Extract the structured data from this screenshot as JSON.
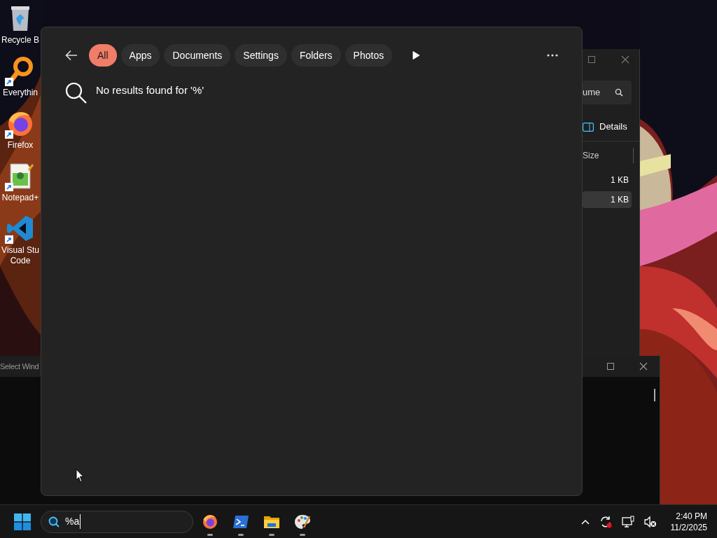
{
  "desktop": {
    "icons": [
      {
        "kind": "bin",
        "lines": [
          "Recycle B"
        ],
        "shortcut": false
      },
      {
        "kind": "magnifier",
        "lines": [
          "Everythin"
        ],
        "shortcut": true
      },
      {
        "kind": "browser",
        "lines": [
          "Firefox"
        ],
        "shortcut": true
      },
      {
        "kind": "notepad",
        "lines": [
          "Notepad+"
        ],
        "shortcut": true
      },
      {
        "kind": "editor",
        "lines": [
          "Visual Stu",
          "Code"
        ],
        "shortcut": true
      }
    ]
  },
  "explorer_window": {
    "search_value": "ume",
    "view_button": "Details",
    "columns": [
      "Size"
    ],
    "rows": [
      {
        "size": "1 KB",
        "selected": false
      },
      {
        "size": "1 KB",
        "selected": true
      }
    ]
  },
  "console_window": {
    "title": "Select Wind"
  },
  "search_panel": {
    "filters": [
      {
        "label": "All",
        "selected": true
      },
      {
        "label": "Apps",
        "selected": false
      },
      {
        "label": "Documents",
        "selected": false
      },
      {
        "label": "Settings",
        "selected": false
      },
      {
        "label": "Folders",
        "selected": false
      },
      {
        "label": "Photos",
        "selected": false
      }
    ],
    "message": "No results found for '%'"
  },
  "taskbar": {
    "search_value": "%a",
    "apps": [
      {
        "kind": "browser",
        "running": true
      },
      {
        "kind": "terminal",
        "running": true
      },
      {
        "kind": "folder",
        "running": true
      },
      {
        "kind": "paint",
        "running": true
      }
    ],
    "time": "2:40 PM",
    "date": "11/2/2025"
  }
}
